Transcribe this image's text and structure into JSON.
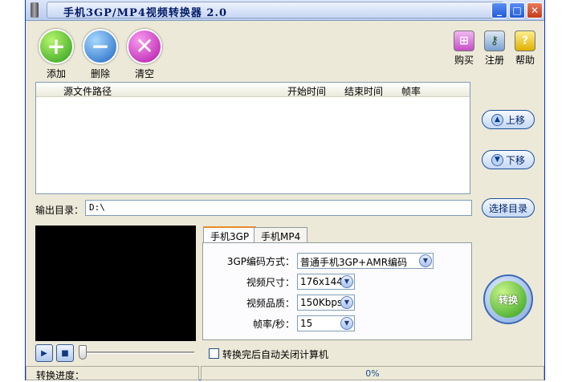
{
  "window": {
    "title": "手机3GP/MP4视频转换器 2.0"
  },
  "toolbar": {
    "add_label": "添加",
    "delete_label": "删除",
    "clear_label": "清空",
    "buy_label": "购买",
    "register_label": "注册",
    "help_label": "帮助"
  },
  "file_list": {
    "columns": [
      "源文件路径",
      "开始时间",
      "结束时间",
      "帧率"
    ]
  },
  "side": {
    "move_up_label": "上移",
    "move_down_label": "下移",
    "choose_dir_label": "选择目录",
    "convert_label": "转换"
  },
  "output": {
    "label": "输出目录：",
    "value": "D:\\"
  },
  "tabs": [
    {
      "label": "手机3GP"
    },
    {
      "label": "手机MP4"
    }
  ],
  "settings": {
    "codec_label": "3GP编码方式：",
    "codec_value": "普通手机3GP+AMR编码",
    "size_label": "视频尺寸：",
    "size_value": "176x144",
    "quality_label": "视频品质：",
    "quality_value": "150Kbps",
    "fps_label": "帧率/秒：",
    "fps_value": "15"
  },
  "playback": {
    "shutdown_label": "转换完后自动关闭计算机"
  },
  "status": {
    "progress_label": "转换进度：",
    "progress_value": "0%"
  }
}
